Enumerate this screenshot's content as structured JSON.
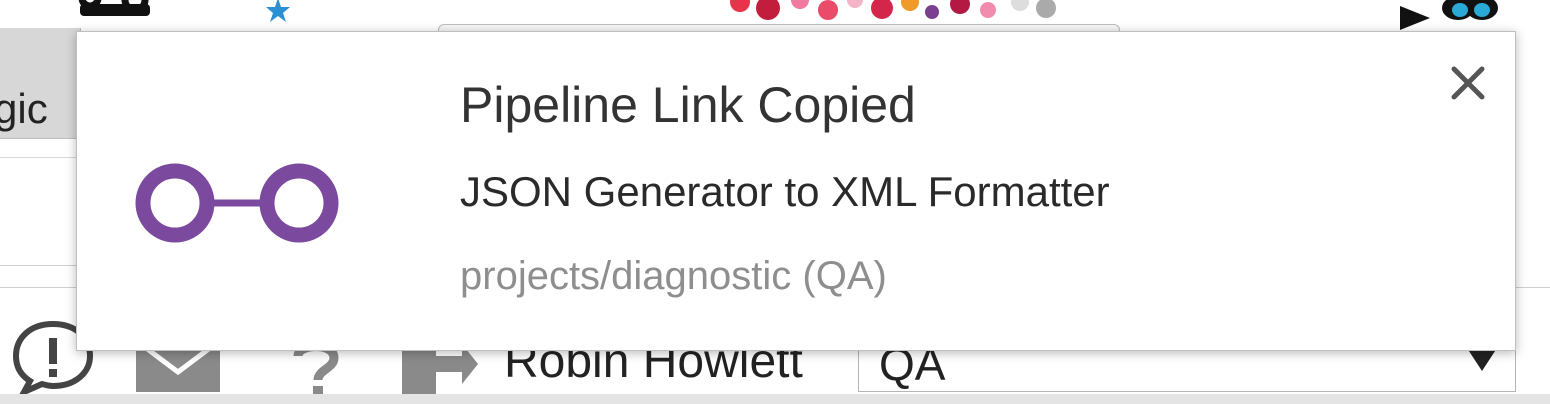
{
  "background": {
    "menu_tab_label": "gic",
    "user_name": "Robin Howlett",
    "environment_select": {
      "value": "QA"
    },
    "icons": {
      "logo": "pipeline-logo-icon",
      "star": "star-icon",
      "flowers": "floral-decoration",
      "butterfly": "butterfly-icon",
      "feedback": "feedback-icon",
      "mail": "mail-icon",
      "help": "help-icon",
      "logout": "logout-icon",
      "dropdown_arrow": "chevron-down-icon"
    }
  },
  "notification": {
    "title": "Pipeline Link Copied",
    "message": "JSON Generator to XML Formatter",
    "context": "projects/diagnostic (QA)",
    "icon": "infinity-logo-icon",
    "close_icon": "close-icon",
    "colors": {
      "logo": "#7b4a9f",
      "title": "#333333",
      "context": "#8e8e8e"
    }
  }
}
